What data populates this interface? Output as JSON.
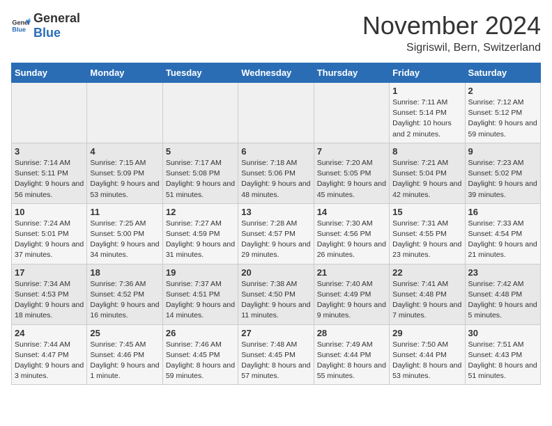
{
  "logo": {
    "general": "General",
    "blue": "Blue"
  },
  "title": "November 2024",
  "location": "Sigriswil, Bern, Switzerland",
  "days_of_week": [
    "Sunday",
    "Monday",
    "Tuesday",
    "Wednesday",
    "Thursday",
    "Friday",
    "Saturday"
  ],
  "weeks": [
    [
      {
        "day": "",
        "info": ""
      },
      {
        "day": "",
        "info": ""
      },
      {
        "day": "",
        "info": ""
      },
      {
        "day": "",
        "info": ""
      },
      {
        "day": "",
        "info": ""
      },
      {
        "day": "1",
        "info": "Sunrise: 7:11 AM\nSunset: 5:14 PM\nDaylight: 10 hours and 2 minutes."
      },
      {
        "day": "2",
        "info": "Sunrise: 7:12 AM\nSunset: 5:12 PM\nDaylight: 9 hours and 59 minutes."
      }
    ],
    [
      {
        "day": "3",
        "info": "Sunrise: 7:14 AM\nSunset: 5:11 PM\nDaylight: 9 hours and 56 minutes."
      },
      {
        "day": "4",
        "info": "Sunrise: 7:15 AM\nSunset: 5:09 PM\nDaylight: 9 hours and 53 minutes."
      },
      {
        "day": "5",
        "info": "Sunrise: 7:17 AM\nSunset: 5:08 PM\nDaylight: 9 hours and 51 minutes."
      },
      {
        "day": "6",
        "info": "Sunrise: 7:18 AM\nSunset: 5:06 PM\nDaylight: 9 hours and 48 minutes."
      },
      {
        "day": "7",
        "info": "Sunrise: 7:20 AM\nSunset: 5:05 PM\nDaylight: 9 hours and 45 minutes."
      },
      {
        "day": "8",
        "info": "Sunrise: 7:21 AM\nSunset: 5:04 PM\nDaylight: 9 hours and 42 minutes."
      },
      {
        "day": "9",
        "info": "Sunrise: 7:23 AM\nSunset: 5:02 PM\nDaylight: 9 hours and 39 minutes."
      }
    ],
    [
      {
        "day": "10",
        "info": "Sunrise: 7:24 AM\nSunset: 5:01 PM\nDaylight: 9 hours and 37 minutes."
      },
      {
        "day": "11",
        "info": "Sunrise: 7:25 AM\nSunset: 5:00 PM\nDaylight: 9 hours and 34 minutes."
      },
      {
        "day": "12",
        "info": "Sunrise: 7:27 AM\nSunset: 4:59 PM\nDaylight: 9 hours and 31 minutes."
      },
      {
        "day": "13",
        "info": "Sunrise: 7:28 AM\nSunset: 4:57 PM\nDaylight: 9 hours and 29 minutes."
      },
      {
        "day": "14",
        "info": "Sunrise: 7:30 AM\nSunset: 4:56 PM\nDaylight: 9 hours and 26 minutes."
      },
      {
        "day": "15",
        "info": "Sunrise: 7:31 AM\nSunset: 4:55 PM\nDaylight: 9 hours and 23 minutes."
      },
      {
        "day": "16",
        "info": "Sunrise: 7:33 AM\nSunset: 4:54 PM\nDaylight: 9 hours and 21 minutes."
      }
    ],
    [
      {
        "day": "17",
        "info": "Sunrise: 7:34 AM\nSunset: 4:53 PM\nDaylight: 9 hours and 18 minutes."
      },
      {
        "day": "18",
        "info": "Sunrise: 7:36 AM\nSunset: 4:52 PM\nDaylight: 9 hours and 16 minutes."
      },
      {
        "day": "19",
        "info": "Sunrise: 7:37 AM\nSunset: 4:51 PM\nDaylight: 9 hours and 14 minutes."
      },
      {
        "day": "20",
        "info": "Sunrise: 7:38 AM\nSunset: 4:50 PM\nDaylight: 9 hours and 11 minutes."
      },
      {
        "day": "21",
        "info": "Sunrise: 7:40 AM\nSunset: 4:49 PM\nDaylight: 9 hours and 9 minutes."
      },
      {
        "day": "22",
        "info": "Sunrise: 7:41 AM\nSunset: 4:48 PM\nDaylight: 9 hours and 7 minutes."
      },
      {
        "day": "23",
        "info": "Sunrise: 7:42 AM\nSunset: 4:48 PM\nDaylight: 9 hours and 5 minutes."
      }
    ],
    [
      {
        "day": "24",
        "info": "Sunrise: 7:44 AM\nSunset: 4:47 PM\nDaylight: 9 hours and 3 minutes."
      },
      {
        "day": "25",
        "info": "Sunrise: 7:45 AM\nSunset: 4:46 PM\nDaylight: 9 hours and 1 minute."
      },
      {
        "day": "26",
        "info": "Sunrise: 7:46 AM\nSunset: 4:45 PM\nDaylight: 8 hours and 59 minutes."
      },
      {
        "day": "27",
        "info": "Sunrise: 7:48 AM\nSunset: 4:45 PM\nDaylight: 8 hours and 57 minutes."
      },
      {
        "day": "28",
        "info": "Sunrise: 7:49 AM\nSunset: 4:44 PM\nDaylight: 8 hours and 55 minutes."
      },
      {
        "day": "29",
        "info": "Sunrise: 7:50 AM\nSunset: 4:44 PM\nDaylight: 8 hours and 53 minutes."
      },
      {
        "day": "30",
        "info": "Sunrise: 7:51 AM\nSunset: 4:43 PM\nDaylight: 8 hours and 51 minutes."
      }
    ]
  ]
}
